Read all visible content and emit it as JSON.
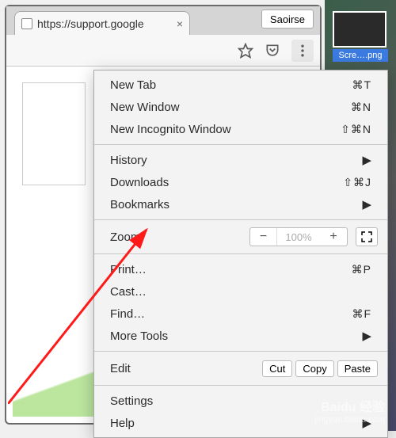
{
  "tabstrip": {
    "tab_url": "https://support.google",
    "profile_name": "Saoirse"
  },
  "desktop_file": "Scre….png",
  "menu": {
    "new_tab": {
      "label": "New Tab",
      "shortcut": "⌘T"
    },
    "new_window": {
      "label": "New Window",
      "shortcut": "⌘N"
    },
    "new_incognito": {
      "label": "New Incognito Window",
      "shortcut": "⇧⌘N"
    },
    "history": {
      "label": "History"
    },
    "downloads": {
      "label": "Downloads",
      "shortcut": "⇧⌘J"
    },
    "bookmarks": {
      "label": "Bookmarks"
    },
    "zoom": {
      "label": "Zoom",
      "percent": "100%"
    },
    "print": {
      "label": "Print…",
      "shortcut": "⌘P"
    },
    "cast": {
      "label": "Cast…"
    },
    "find": {
      "label": "Find…",
      "shortcut": "⌘F"
    },
    "more_tools": {
      "label": "More Tools"
    },
    "edit": {
      "label": "Edit",
      "cut": "Cut",
      "copy": "Copy",
      "paste": "Paste"
    },
    "settings": {
      "label": "Settings"
    },
    "help": {
      "label": "Help"
    }
  },
  "watermark": {
    "brand": "Baidu 经验",
    "url": "jingyan.baidu.com"
  }
}
